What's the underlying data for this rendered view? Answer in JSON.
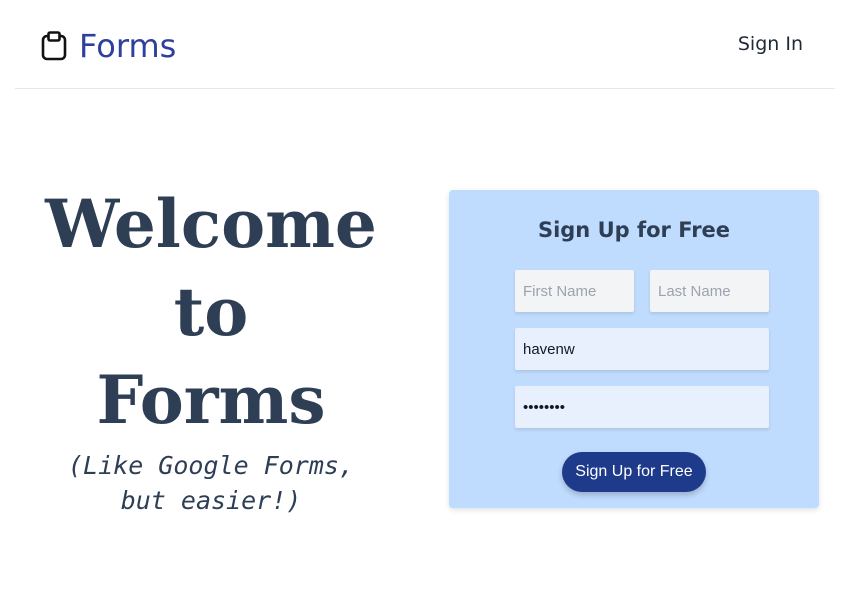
{
  "header": {
    "brand_name": "Forms",
    "brand_icon": "clipboard-icon",
    "signin_label": "Sign In"
  },
  "hero": {
    "title_lines": [
      "Welcome",
      "to",
      "Forms"
    ],
    "subtitle_lines": [
      "(Like Google Forms,",
      "but easier!)"
    ]
  },
  "signup": {
    "title": "Sign Up for Free",
    "first_name_placeholder": "First Name",
    "last_name_placeholder": "Last Name",
    "username_value": "havenw",
    "password_value": "••••••••",
    "submit_label": "Sign Up for Free"
  },
  "colors": {
    "brand": "#2e3f9c",
    "card_bg": "#bfdbfe",
    "button_bg": "#1e3a8a",
    "heading_text": "#2d3e55"
  }
}
